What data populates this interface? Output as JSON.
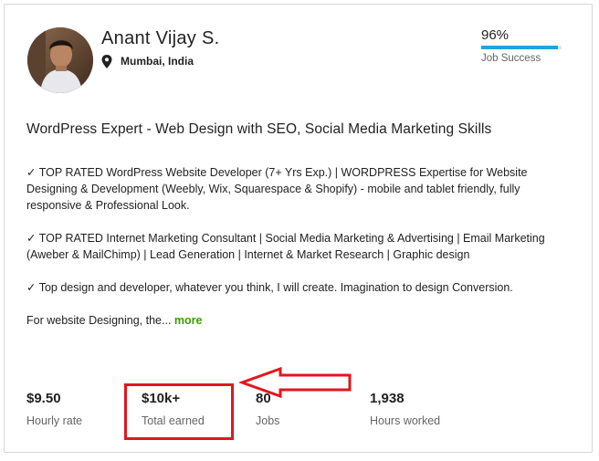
{
  "profile": {
    "name": "Anant Vijay S.",
    "location": "Mumbai, India",
    "job_success": {
      "value": "96%",
      "percent": 96,
      "label": "Job Success"
    }
  },
  "title": "WordPress Expert - Web Design with SEO, Social Media Marketing Skills",
  "description": {
    "paragraphs": [
      "✓ TOP RATED WordPress Website Developer (7+ Yrs Exp.) | WORDPRESS Expertise for Website Designing & Development (Weebly, Wix, Squarespace & Shopify) - mobile and tablet friendly, fully responsive & Professional Look.",
      "✓ TOP RATED Internet Marketing Consultant | Social Media Marketing & Advertising | Email Marketing (Aweber & MailChimp) | Lead Generation | Internet & Market Research | Graphic design",
      "✓ Top design and developer, whatever you think, I will create. Imagination to design Conversion."
    ],
    "truncated": "For website Designing, the...",
    "more_label": "more"
  },
  "stats": [
    {
      "value": "$9.50",
      "label": "Hourly rate"
    },
    {
      "value": "$10k+",
      "label": "Total earned"
    },
    {
      "value": "80",
      "label": "Jobs"
    },
    {
      "value": "1,938",
      "label": "Hours worked"
    }
  ],
  "colors": {
    "accent_bar": "#1fa5d8",
    "more_link": "#37a000",
    "annotation": "#e3161e"
  },
  "icons": {
    "location": "map-pin-icon"
  }
}
